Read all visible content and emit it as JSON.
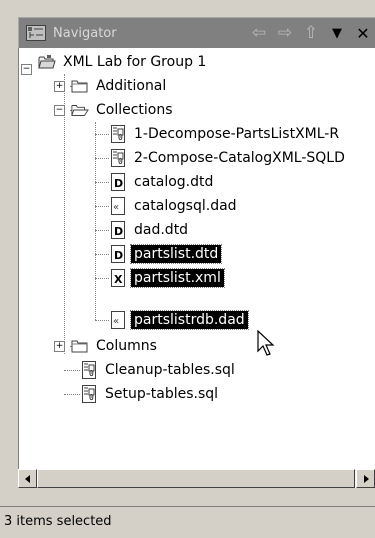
{
  "view": {
    "title": "Navigator",
    "icon": "navigator-view-icon",
    "toolbar": [
      {
        "name": "back-arrow-icon",
        "glyph": "⇦"
      },
      {
        "name": "forward-arrow-icon",
        "glyph": "⇨"
      },
      {
        "name": "up-arrow-icon",
        "glyph": "⇧"
      },
      {
        "name": "view-menu-icon",
        "glyph": "▼"
      },
      {
        "name": "close-icon",
        "glyph": "✕"
      }
    ]
  },
  "tree": {
    "project": {
      "label": "XML Lab for Group 1",
      "icon": "project-folder-icon",
      "expanded": true
    },
    "additional": {
      "label": "Additional",
      "icon": "folder-icon",
      "expanded": false
    },
    "collections": {
      "label": "Collections",
      "icon": "open-folder-icon",
      "expanded": true,
      "items": [
        {
          "label": "1-Decompose-PartsListXML-R",
          "icon": "sql-file-icon",
          "selected": false
        },
        {
          "label": "2-Compose-CatalogXML-SQLD",
          "icon": "sql-file-icon",
          "selected": false
        },
        {
          "label": "catalog.dtd",
          "icon": "dtd-file-icon",
          "selected": false
        },
        {
          "label": "catalogsql.dad",
          "icon": "dad-file-icon",
          "selected": false
        },
        {
          "label": "dad.dtd",
          "icon": "dtd-file-icon",
          "selected": false
        },
        {
          "label": "partslist.dtd",
          "icon": "dtd-file-icon",
          "selected": true
        },
        {
          "label": "partslist.xml",
          "icon": "xml-file-icon",
          "selected": true
        },
        {
          "label": "partslistrdb.dad",
          "icon": "dad-file-icon",
          "selected": true
        }
      ]
    },
    "columns": {
      "label": "Columns",
      "icon": "folder-icon",
      "expanded": false
    },
    "cleanup": {
      "label": "Cleanup-tables.sql",
      "icon": "sql-file-icon"
    },
    "setup": {
      "label": "Setup-tables.sql",
      "icon": "sql-file-icon"
    }
  },
  "status": {
    "text": "3 items selected"
  }
}
